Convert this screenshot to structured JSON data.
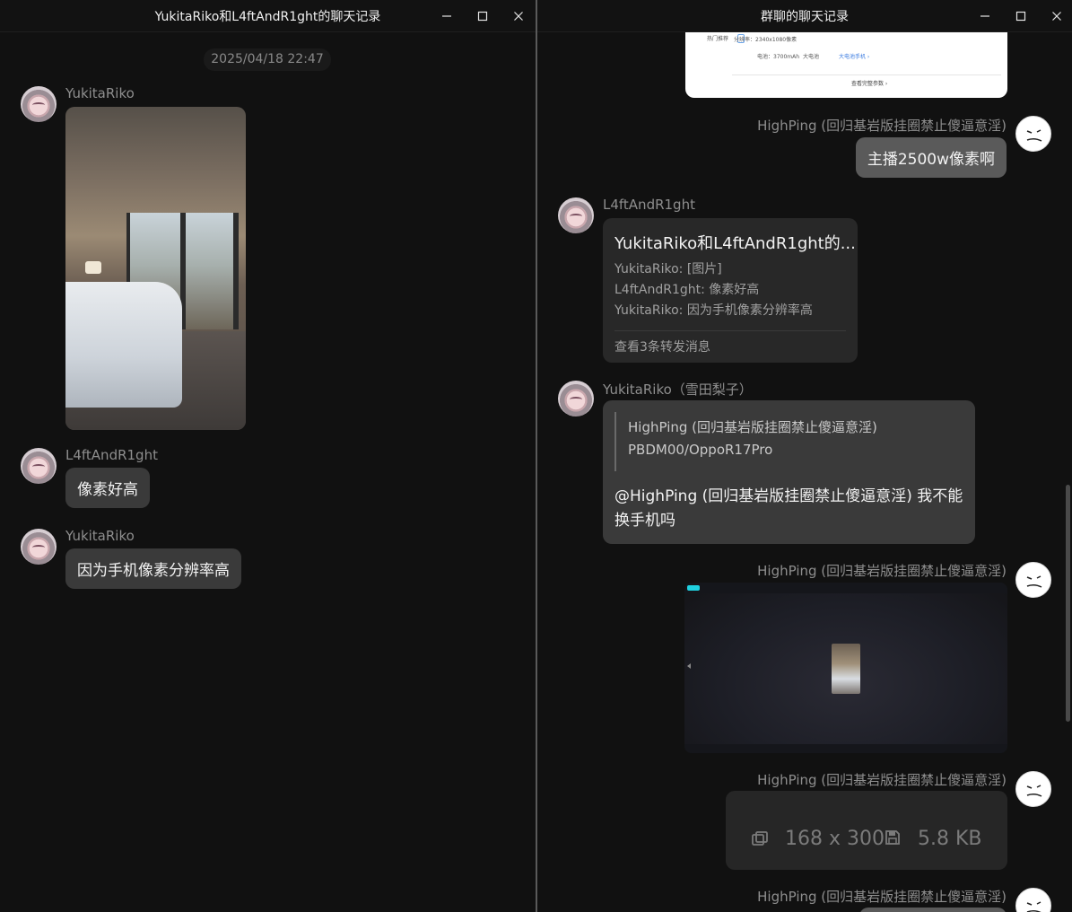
{
  "left_window": {
    "title": "YukitaRiko和L4ftAndR1ght的聊天记录",
    "timestamp": "2025/04/18 22:47",
    "messages": [
      {
        "sender": "YukitaRiko",
        "type": "image"
      },
      {
        "sender": "L4ftAndR1ght",
        "text": "像素好高"
      },
      {
        "sender": "YukitaRiko",
        "text": "因为手机像素分辨率高"
      }
    ]
  },
  "right_window": {
    "title": "群聊的聊天记录",
    "spec_card": {
      "row1": "分辨率：2340x1080像素",
      "row1_tag": "热门推荐",
      "row2": "电池：3700mAh",
      "row2_mid": "大电池",
      "row2_link": "大电池手机 ›",
      "more": "查看完整参数 ›"
    },
    "msg1": {
      "sender": "HighPing (回归基岩版挂圈禁止傻逼意淫)",
      "text": "主播2500w像素啊"
    },
    "forward": {
      "sender": "L4ftAndR1ght",
      "title": "YukitaRiko和L4ftAndR1ght的...",
      "lines": [
        "YukitaRiko: [图片]",
        "L4ftAndR1ght: 像素好高",
        "YukitaRiko: 因为手机像素分辨率高"
      ],
      "footer": "查看3条转发消息"
    },
    "reply": {
      "sender": "YukitaRiko（雪田梨子）",
      "quote_name": "HighPing (回归基岩版挂圈禁止傻逼意淫)",
      "quote_text": "PBDM00/OppoR17Pro",
      "body": "@HighPing (回归基岩版挂圈禁止傻逼意淫) 我不能换手机吗"
    },
    "msg_screenshot": {
      "sender": "HighPing (回归基岩版挂圈禁止傻逼意淫)"
    },
    "msg_file": {
      "sender": "HighPing (回归基岩版挂圈禁止傻逼意淫)",
      "dimensions": "168 x 300",
      "size": "5.8 KB"
    },
    "msg_last": {
      "sender": "HighPing (回归基岩版挂圈禁止傻逼意淫)"
    }
  },
  "colors": {
    "background": "#111111",
    "bubble": "#3a3a3a",
    "name": "#8e8e8e"
  },
  "icons": [
    "minimize-icon",
    "maximize-icon",
    "close-icon",
    "image-size-icon",
    "save-icon"
  ]
}
